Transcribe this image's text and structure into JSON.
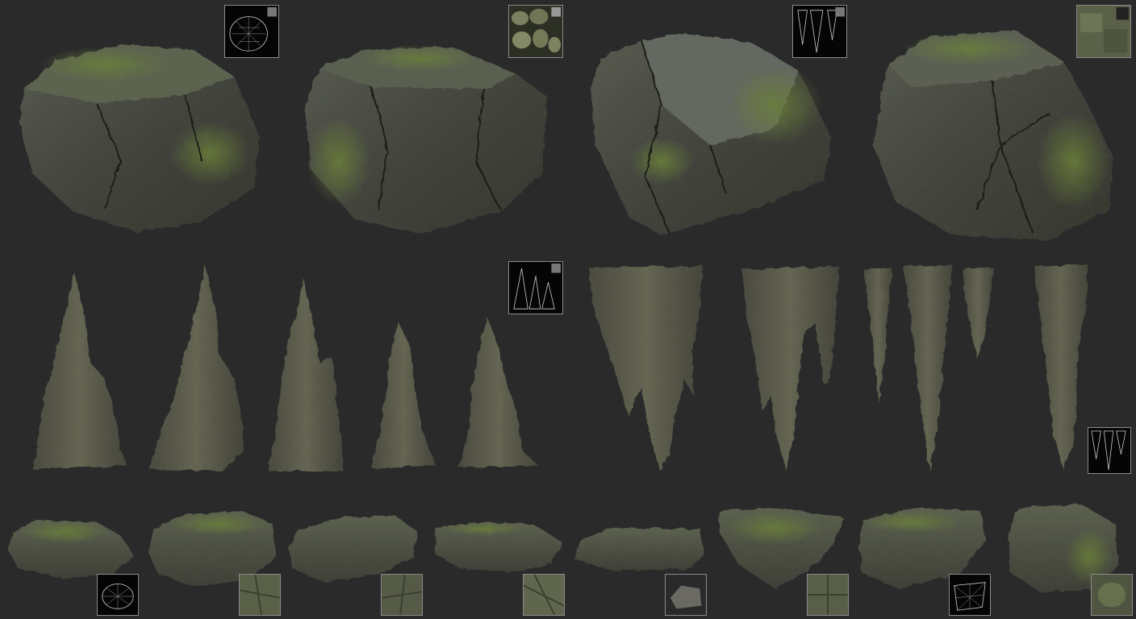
{
  "palette": {
    "background": "#2a2a2b",
    "rock_dark": "#2f322d",
    "rock_mid": "#4a4d45",
    "moss": "#5d6e37",
    "cave_stone": "#5f5e4c",
    "thumb_border": "#8a8a8a"
  },
  "sections": {
    "boulders": {
      "count": 4,
      "icon": "boulder-icon"
    },
    "stalagmites": {
      "count": 5,
      "icon": "stalagmite-icon"
    },
    "stalactites": {
      "count": 6,
      "icon": "stalactite-icon"
    },
    "flat_stones": {
      "count": 8,
      "icon": "flat-stone-icon"
    }
  },
  "thumbnails": [
    {
      "kind": "wireframe",
      "icon": "wireframe-icon"
    },
    {
      "kind": "texture-atlas",
      "icon": "texture-atlas-icon"
    },
    {
      "kind": "wireframe",
      "icon": "wireframe-icon"
    },
    {
      "kind": "texture",
      "icon": "texture-icon"
    },
    {
      "kind": "wireframe",
      "icon": "wireframe-icon"
    },
    {
      "kind": "wireframe",
      "icon": "wireframe-icon"
    },
    {
      "kind": "wireframe",
      "icon": "wireframe-icon"
    },
    {
      "kind": "texture",
      "icon": "texture-icon"
    },
    {
      "kind": "texture",
      "icon": "texture-icon"
    },
    {
      "kind": "texture",
      "icon": "texture-icon"
    },
    {
      "kind": "texture",
      "icon": "texture-icon"
    },
    {
      "kind": "texture",
      "icon": "texture-icon"
    },
    {
      "kind": "wireframe",
      "icon": "wireframe-icon"
    },
    {
      "kind": "texture",
      "icon": "texture-icon"
    }
  ]
}
